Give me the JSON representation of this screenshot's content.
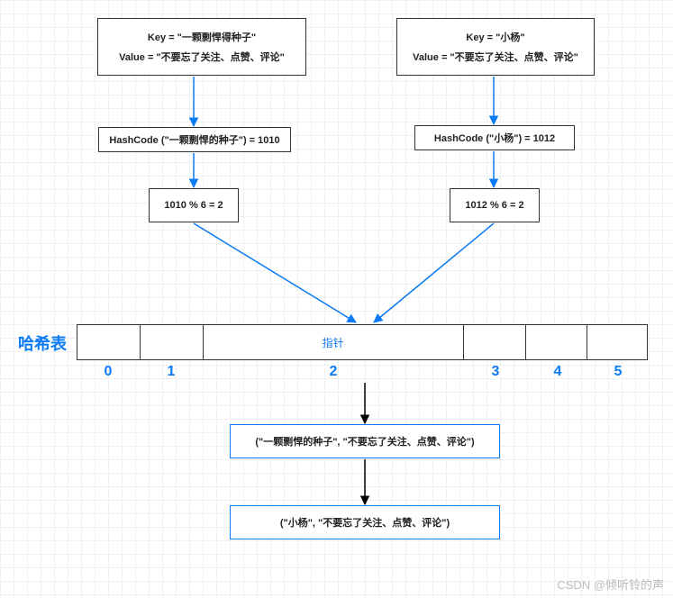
{
  "left": {
    "key_line": "Key = \"一颗剽悍得种子\"",
    "value_line": "Value = \"不要忘了关注、点赞、评论\"",
    "hashcode": "HashCode (\"一颗剽悍的种子\") = 1010",
    "mod": "1010 % 6 = 2"
  },
  "right": {
    "key_line": "Key = \"小杨\"",
    "value_line": "Value = \"不要忘了关注、点赞、评论\"",
    "hashcode": "HashCode (\"小杨\") = 1012",
    "mod": "1012 % 6 = 2"
  },
  "hash_table": {
    "label": "哈希表",
    "pointer_label": "指针",
    "indices": [
      "0",
      "1",
      "2",
      "3",
      "4",
      "5"
    ]
  },
  "results": {
    "first": "(\"一颗剽悍的种子\", \"不要忘了关注、点赞、评论\")",
    "second": "(\"小杨\", \"不要忘了关注、点赞、评论\")"
  },
  "watermark": "CSDN @倾听铃的声"
}
